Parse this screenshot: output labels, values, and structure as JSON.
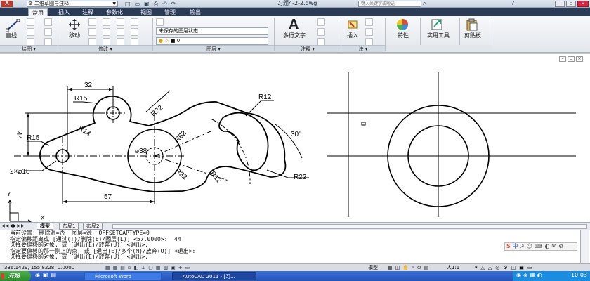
{
  "window": {
    "workspace": "二维草图与注释",
    "file_title": "习题4-2-2.dwg",
    "search_placeholder": "键入关键字或短语"
  },
  "ribbon_tabs": [
    "常用",
    "插入",
    "注释",
    "参数化",
    "视图",
    "管理",
    "输出"
  ],
  "ribbon": {
    "draw": {
      "line_label": "直线",
      "panel": "绘图"
    },
    "modify": {
      "move_label": "移动",
      "panel": "修改"
    },
    "layers": {
      "layer_state": "未保存的图层状态",
      "current_layer": "0",
      "panel": "图层"
    },
    "annotation": {
      "mtext_label": "多行文字",
      "panel": "注释"
    },
    "block": {
      "insert_label": "插入",
      "panel": "块"
    },
    "properties": {
      "label": "特性"
    },
    "utilities": {
      "label": "实用工具"
    },
    "clipboard": {
      "label": "剪贴板"
    }
  },
  "drawing": {
    "dims": {
      "d32": "32",
      "r15_top": "R15",
      "r32": "R32",
      "r12_top": "R12",
      "r14": "R14",
      "r15_left": "R15",
      "d44": "44",
      "r62": "R62",
      "d38": "⌀38",
      "deg30": "30°",
      "two_d18": "2×⌀18",
      "r32_b": "R32",
      "r12_b": "R12",
      "r22": "R22",
      "d57": "57"
    },
    "ucs": {
      "y": "Y",
      "x": "X"
    }
  },
  "layout_tabs": [
    "模型",
    "布局1",
    "布局2"
  ],
  "command_lines": [
    "当前设置: 删除源=否  图层=源  OFFSETGAPTYPE=0",
    "指定偏移距离或 [通过(T)/删除(E)/图层(L)] <57.0000>:  44",
    "选择要偏移的对象, 或 [退出(E)/放弃(U)] <退出>:",
    "指定要偏移的那一侧上的点, 或 [退出(E)/多个(M)/放弃(U)] <退出>:",
    "选择要偏移的对象, 或 [退出(E)/放弃(U)] <退出>:"
  ],
  "status": {
    "coords": "336.1429, 155.8228, 0.0000",
    "model": "模型",
    "scale": "人1:1"
  },
  "taskbar": {
    "start": "开始",
    "tasks": [
      "Microsoft Word",
      "AutoCAD 2011 - [习..."
    ],
    "time": "10:03",
    "ime": "中"
  }
}
